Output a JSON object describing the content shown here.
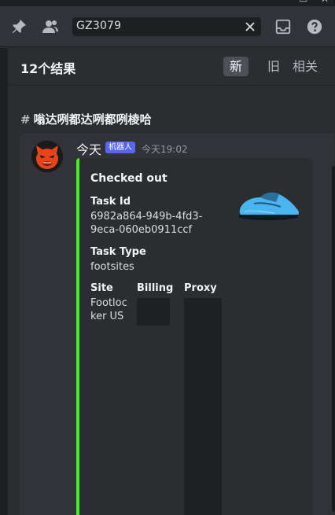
{
  "toolbar": {
    "search_value": "GZ3079",
    "icons": [
      "pin-icon",
      "members-icon",
      "close-icon",
      "inbox-icon",
      "help-icon"
    ]
  },
  "results": {
    "count_label": "12个结果",
    "sort_tabs": [
      {
        "label": "新",
        "active": true
      },
      {
        "label": "旧",
        "active": false
      },
      {
        "label": "相关",
        "active": false
      }
    ]
  },
  "channel": {
    "hash": "#",
    "name": "嗡达咧都达咧都咧棱哈"
  },
  "message": {
    "author": "今天",
    "bot_tag": "机器人",
    "timestamp": "今天19:02",
    "embed": {
      "accent_color": "#3ff31a",
      "title": "Checked out",
      "fields": [
        {
          "name": "Task Id",
          "value": "6982a864-949b-4fd3-9eca-060eb0911ccf"
        },
        {
          "name": "Task Type",
          "value": "footsites"
        },
        {
          "name": "Site",
          "value": "Footlocker US"
        },
        {
          "name": "Billing",
          "value": ""
        },
        {
          "name": "Proxy",
          "value": ""
        }
      ]
    }
  },
  "colors": {
    "background": "#2b2d31",
    "toolbar": "#313338",
    "bot_tag": "#5865f2",
    "active_tab": "#4e5058"
  }
}
